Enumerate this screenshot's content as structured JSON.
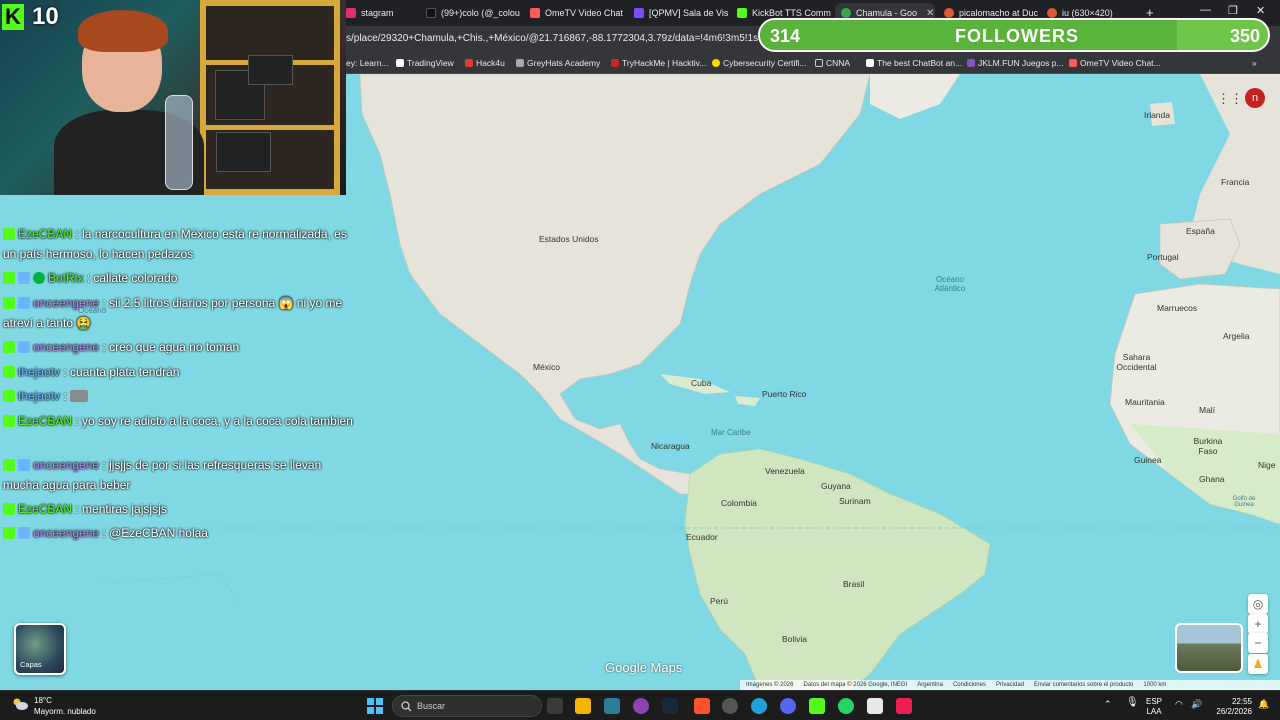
{
  "browser": {
    "tabs": [
      {
        "label": "stagram",
        "active": false,
        "color": "#e1306c"
      },
      {
        "label": "(99+)colo (@_colou",
        "active": false,
        "color": "#111111"
      },
      {
        "label": "OmeTV Video Chat",
        "active": false,
        "color": "#ff5a5a"
      },
      {
        "label": "[QPMV] Sala de Vis",
        "active": false,
        "color": "#7b4dff"
      },
      {
        "label": "KickBot TTS Comm",
        "active": false,
        "color": "#53fc18"
      },
      {
        "label": "Chamula - Goo",
        "active": true,
        "color": "#34a853"
      },
      {
        "label": "picalomacho at Duc",
        "active": false,
        "color": "#de5833"
      },
      {
        "label": "iu (630×420)",
        "active": false,
        "color": "#de5833"
      }
    ],
    "new_tab": "+",
    "url": "s/place/29320+Chamula,+Chis.,+México/@21.716867,-88.1772304,3.79z/data=!4m6!3m5!1s0x85ed",
    "bookmarks": [
      {
        "label": "ey: Learn...",
        "color": "#888888"
      },
      {
        "label": "TradingView",
        "color": "#ffffff"
      },
      {
        "label": "Hack4u",
        "color": "#e53935"
      },
      {
        "label": "GreyHats Academy",
        "color": "#aaaaaa"
      },
      {
        "label": "TryHackMe | Hacktiv...",
        "color": "#c62828"
      },
      {
        "label": "Cybersecurity Certifi...",
        "color": "#ffd600"
      },
      {
        "label": "CNNA",
        "color": "#cccccc"
      },
      {
        "label": "The best ChatBot an...",
        "color": "#ffffff"
      },
      {
        "label": "JKLM.FUN Juegos p...",
        "color": "#7e57c2"
      },
      {
        "label": "OmeTV Video Chat...",
        "color": "#ff5a5a"
      }
    ],
    "bookmarks_more": "»"
  },
  "map": {
    "labels": {
      "estados_unidos": "Estados Unidos",
      "mexico": "México",
      "cuba": "Cuba",
      "puerto_rico": "Puerto Rico",
      "nicaragua": "Nicaragua",
      "mar_caribe": "Mar Caribe",
      "venezuela": "Venezuela",
      "guyana": "Guyana",
      "surinam": "Surinam",
      "colombia": "Colombia",
      "ecuador": "Ecuador",
      "peru": "Perú",
      "brasil": "Brasil",
      "bolivia": "Bolivia",
      "oceano_atlantico": "Océano Atlántico",
      "oceano_left": "Océano",
      "irlanda": "Irlanda",
      "francia": "Francia",
      "espana": "España",
      "portugal": "Portugal",
      "marruecos": "Marruecos",
      "argelia": "Argelia",
      "sahara": "Sahara Occidental",
      "mauritania": "Mauritania",
      "mali": "Malí",
      "burkina": "Burkina Faso",
      "guinea": "Guinea",
      "ghana": "Ghana",
      "nige": "Nige",
      "golfo_guinea": "Golfo de Guinea"
    },
    "google_maps_logo": "Google Maps",
    "layers_label": "Capas",
    "account_initial": "n",
    "zoom_in": "+",
    "zoom_out": "−",
    "attribution": [
      "Imágenes © 2026",
      "Datos del mapa © 2026 Google, INEGI",
      "Argentina",
      "Condiciones",
      "Privacidad",
      "Enviar comentarios sobre el producto",
      "1000 km"
    ]
  },
  "stream": {
    "viewer_count": "10",
    "kick_letter": "K",
    "followers": {
      "current": "314",
      "label": "FOLLOWERS",
      "goal": "350",
      "progress": 0.82
    },
    "chat": [
      {
        "user": "EzeCBAN",
        "user_color": "#53fc18",
        "badges": [
          "k"
        ],
        "text": ": la narcocultura en México está re normalizada, es un país hermoso, lo hacen pedazos"
      },
      {
        "user": "BotRix",
        "user_color": "#53fc18",
        "badges": [
          "k",
          "s",
          "v"
        ],
        "text": ": callate colorado"
      },
      {
        "user": "onceengene",
        "user_color": "#c27bff",
        "badges": [
          "k",
          "s"
        ],
        "text": ": sii 2.5 litros diarios por persona 😱 ni yo me atreví a tanto 🤮"
      },
      {
        "user": "onceengene",
        "user_color": "#c27bff",
        "badges": [
          "k",
          "s"
        ],
        "text": ": creo que agua no toman"
      },
      {
        "user": "thejaotv",
        "user_color": "#6cb4ff",
        "badges": [
          "k"
        ],
        "text": ": cuanta plata tendrán"
      },
      {
        "user": "thejaotv",
        "user_color": "#6cb4ff",
        "badges": [
          "k"
        ],
        "text": ":"
      },
      {
        "user": "EzeCBAN",
        "user_color": "#53fc18",
        "badges": [
          "k"
        ],
        "text": ": yo soy re adicto a la coca, y a la coca cola tambien"
      },
      {
        "user": "onceengene",
        "user_color": "#c27bff",
        "badges": [
          "k",
          "s"
        ],
        "text": ": jjsjjs de por si las refresqueras se llevan mucha agua para beber"
      },
      {
        "user": "EzeCBAN",
        "user_color": "#53fc18",
        "badges": [
          "k"
        ],
        "text": ": mentiras jajsjsjs"
      },
      {
        "user": "onceengene",
        "user_color": "#c27bff",
        "badges": [
          "k",
          "s"
        ],
        "text": ": @EzeCBAN holaa"
      }
    ]
  },
  "taskbar": {
    "weather_temp": "18°C",
    "weather_desc": "Mayorm. nublado",
    "search_label": "Buscar",
    "lang_top": "ESP",
    "lang_bottom": "LAA",
    "time": "22:55",
    "date": "26/2/2026"
  }
}
